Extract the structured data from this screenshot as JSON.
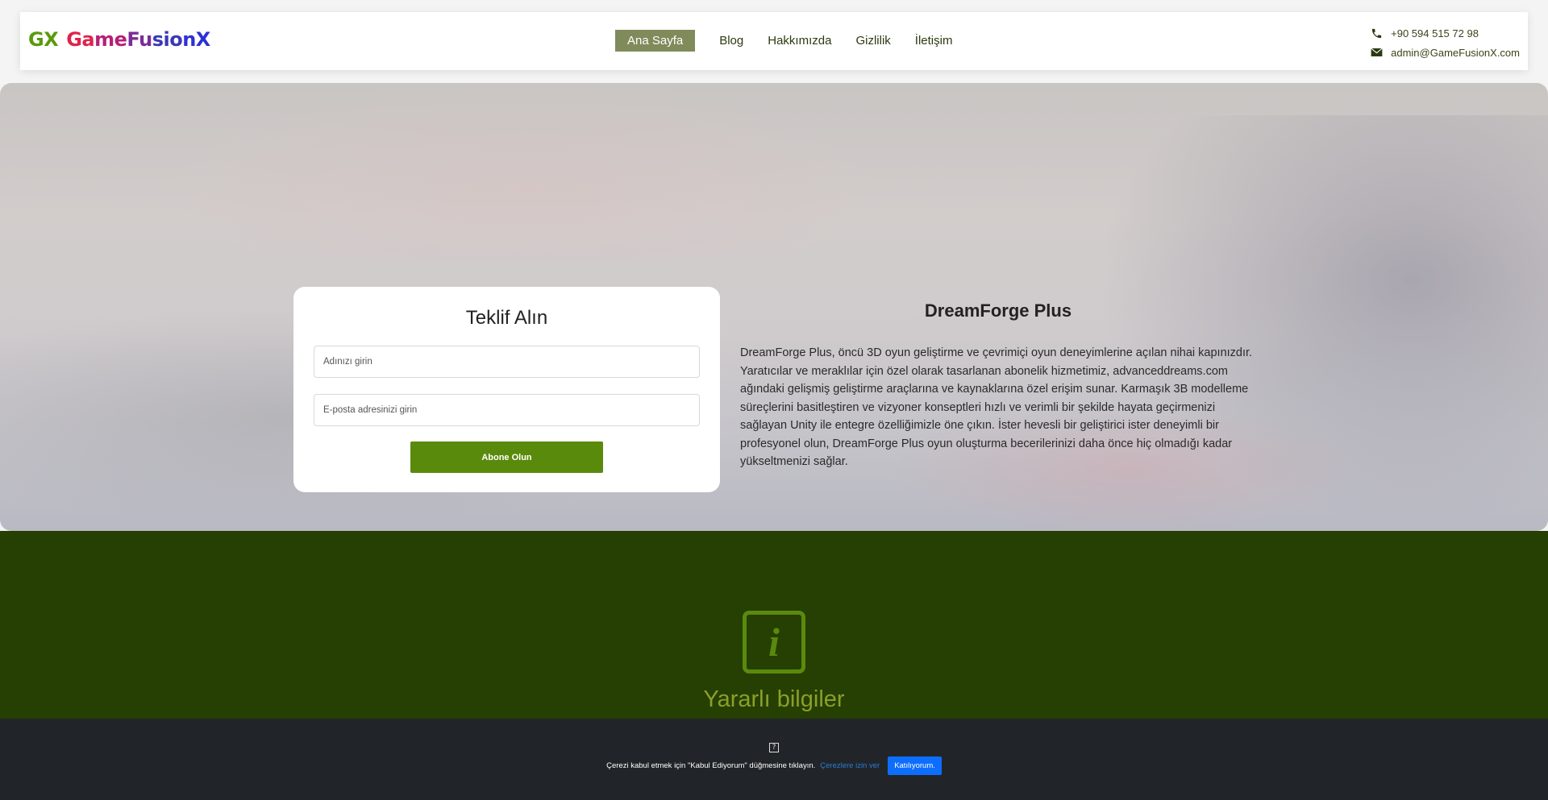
{
  "header": {
    "logo": {
      "part1": "GX",
      "part2": "GameFusionX"
    },
    "nav": {
      "home": "Ana Sayfa",
      "blog": "Blog",
      "about": "Hakkımızda",
      "privacy": "Gizlilik",
      "contact": "İletişim"
    },
    "contact": {
      "phone": "+90 594 515 72 98",
      "email": "admin@GameFusionX.com"
    }
  },
  "form": {
    "title": "Teklif Alın",
    "name_placeholder": "Adınızı girin",
    "email_placeholder": "E-posta adresinizi girin",
    "submit_label": "Abone Olun"
  },
  "product": {
    "title": "DreamForge Plus",
    "description": "DreamForge Plus, öncü 3D oyun geliştirme ve çevrimiçi oyun deneyimlerine açılan nihai kapınızdır. Yaratıcılar ve meraklılar için özel olarak tasarlanan abonelik hizmetimiz, advanceddreams.com ağındaki gelişmiş geliştirme araçlarına ve kaynaklarına özel erişim sunar. Karmaşık 3B modelleme süreçlerini basitleştiren ve vizyoner konseptleri hızlı ve verimli bir şekilde hayata geçirmenizi sağlayan Unity ile entegre özelliğimizle öne çıkın. İster hevesli bir geliştirici ister deneyimli bir profesyonel olun, DreamForge Plus oyun oluşturma becerilerinizi daha önce hiç olmadığı kadar yükseltmenizi sağlar."
  },
  "info_section": {
    "title": "Yararlı bilgiler",
    "icon": "info-icon"
  },
  "cookie": {
    "glyph": "?",
    "text": "Çerezi kabul etmek için \"Kabul Ediyorum\" düğmesine tıklayın.",
    "allow_link": "Çerezlere izin ver",
    "accept_label": "Katılıyorum."
  },
  "colors": {
    "brand_green": "#5a8a0c",
    "dark_green": "#263f02",
    "nav_active": "#7f8b5a",
    "cookie_bg": "#212529",
    "accept_blue": "#0d6efd"
  }
}
